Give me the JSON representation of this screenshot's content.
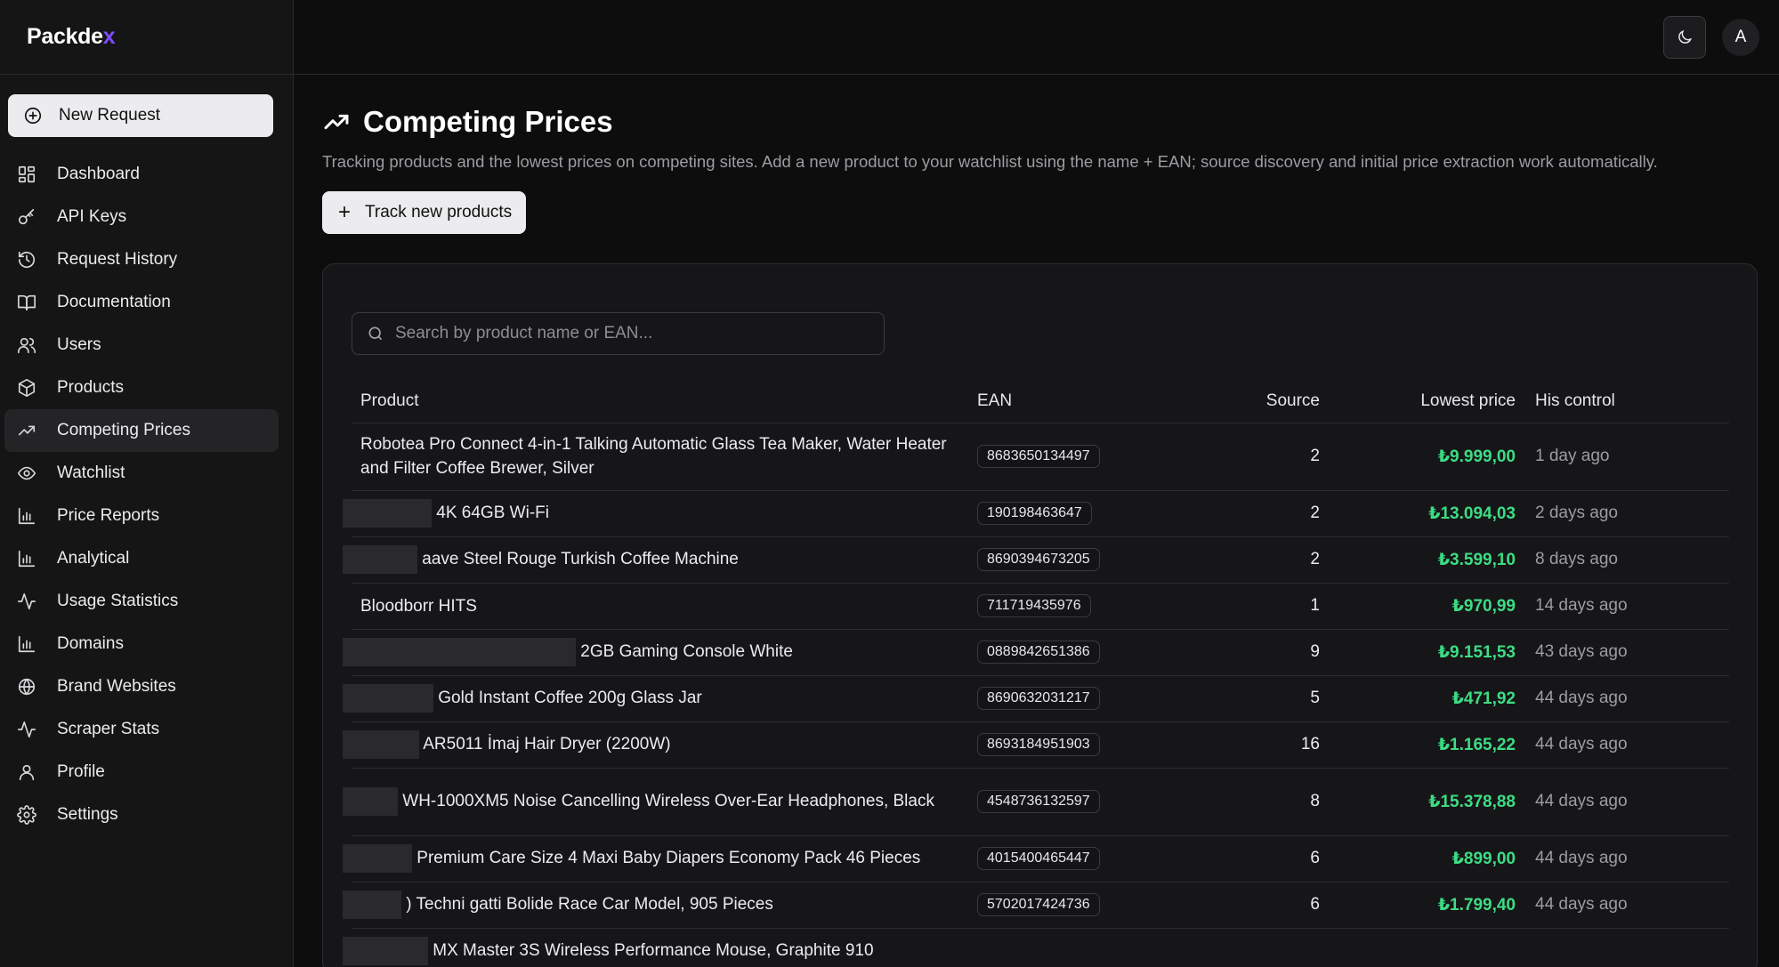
{
  "brand": {
    "name_main": "Packde",
    "name_accent": "x"
  },
  "sidebar": {
    "new_request": "New Request",
    "items": [
      {
        "label": "Dashboard",
        "icon": "dashboard-icon"
      },
      {
        "label": "API Keys",
        "icon": "key-icon"
      },
      {
        "label": "Request History",
        "icon": "history-icon"
      },
      {
        "label": "Documentation",
        "icon": "book-icon"
      },
      {
        "label": "Users",
        "icon": "users-icon"
      },
      {
        "label": "Products",
        "icon": "package-icon"
      },
      {
        "label": "Competing Prices",
        "icon": "trending-up-icon",
        "active": true
      },
      {
        "label": "Watchlist",
        "icon": "eye-icon"
      },
      {
        "label": "Price Reports",
        "icon": "bar-chart-icon"
      },
      {
        "label": "Analytical",
        "icon": "bar-chart-icon"
      },
      {
        "label": "Usage Statistics",
        "icon": "activity-icon"
      },
      {
        "label": "Domains",
        "icon": "bar-chart-icon"
      },
      {
        "label": "Brand Websites",
        "icon": "globe-icon"
      },
      {
        "label": "Scraper Stats",
        "icon": "activity-icon"
      },
      {
        "label": "Profile",
        "icon": "user-icon"
      },
      {
        "label": "Settings",
        "icon": "gear-icon"
      }
    ]
  },
  "topbar": {
    "avatar_initial": "A",
    "theme_icon": "moon-icon"
  },
  "page": {
    "title": "Competing Prices",
    "description": "Tracking products and the lowest prices on competing sites. Add a new product to your watchlist using the name + EAN; source discovery and initial price extraction work automatically.",
    "track_button": "Track new products"
  },
  "search": {
    "placeholder": "Search by product name or EAN..."
  },
  "table": {
    "headers": {
      "product": "Product",
      "ean": "EAN",
      "source": "Source",
      "lowest_price": "Lowest price",
      "his_control": "His control"
    },
    "rows": [
      {
        "product": "Robotea Pro Connect 4-in-1 Talking Automatic Glass Tea Maker, Water Heater and Filter Coffee Brewer, Silver",
        "ean": "8683650134497",
        "source": "2",
        "price": "₺9.999,00",
        "ago": "1 day ago",
        "tall": true
      },
      {
        "product": "4K 64GB Wi-Fi",
        "ean": "190198463647",
        "source": "2",
        "price": "₺13.094,03",
        "ago": "2 days ago",
        "redact": 100
      },
      {
        "product": "aave Steel Rouge Turkish Coffee Machine",
        "ean": "8690394673205",
        "source": "2",
        "price": "₺3.599,10",
        "ago": "8 days ago",
        "redact": 84
      },
      {
        "product": "Bloodborr        HITS",
        "ean": "711719435976",
        "source": "1",
        "price": "₺970,99",
        "ago": "14 days ago"
      },
      {
        "product": "2GB Gaming Console White",
        "ean": "0889842651386",
        "source": "9",
        "price": "₺9.151,53",
        "ago": "43 days ago",
        "redact": 262
      },
      {
        "product": "Gold Instant Coffee 200g Glass Jar",
        "ean": "8690632031217",
        "source": "5",
        "price": "₺471,92",
        "ago": "44 days ago",
        "redact": 102
      },
      {
        "product": "AR5011 İmaj Hair Dryer (2200W)",
        "ean": "8693184951903",
        "source": "16",
        "price": "₺1.165,22",
        "ago": "44 days ago",
        "redact": 86
      },
      {
        "product": "WH-1000XM5 Noise Cancelling Wireless Over-Ear Headphones, Black",
        "ean": "4548736132597",
        "source": "8",
        "price": "₺15.378,88",
        "ago": "44 days ago",
        "tall": true,
        "redact": 62
      },
      {
        "product": "Premium Care Size 4 Maxi Baby Diapers Economy Pack 46 Pieces",
        "ean": "4015400465447",
        "source": "6",
        "price": "₺899,00",
        "ago": "44 days ago",
        "redact": 78
      },
      {
        "product": ") Techni             gatti Bolide Race Car Model, 905 Pieces",
        "ean": "5702017424736",
        "source": "6",
        "price": "₺1.799,40",
        "ago": "44 days ago",
        "redact": 66
      },
      {
        "product": "MX Master 3S Wireless Performance Mouse, Graphite 910",
        "ean": "",
        "source": "",
        "price": "",
        "ago": "",
        "redact": 96
      }
    ]
  }
}
